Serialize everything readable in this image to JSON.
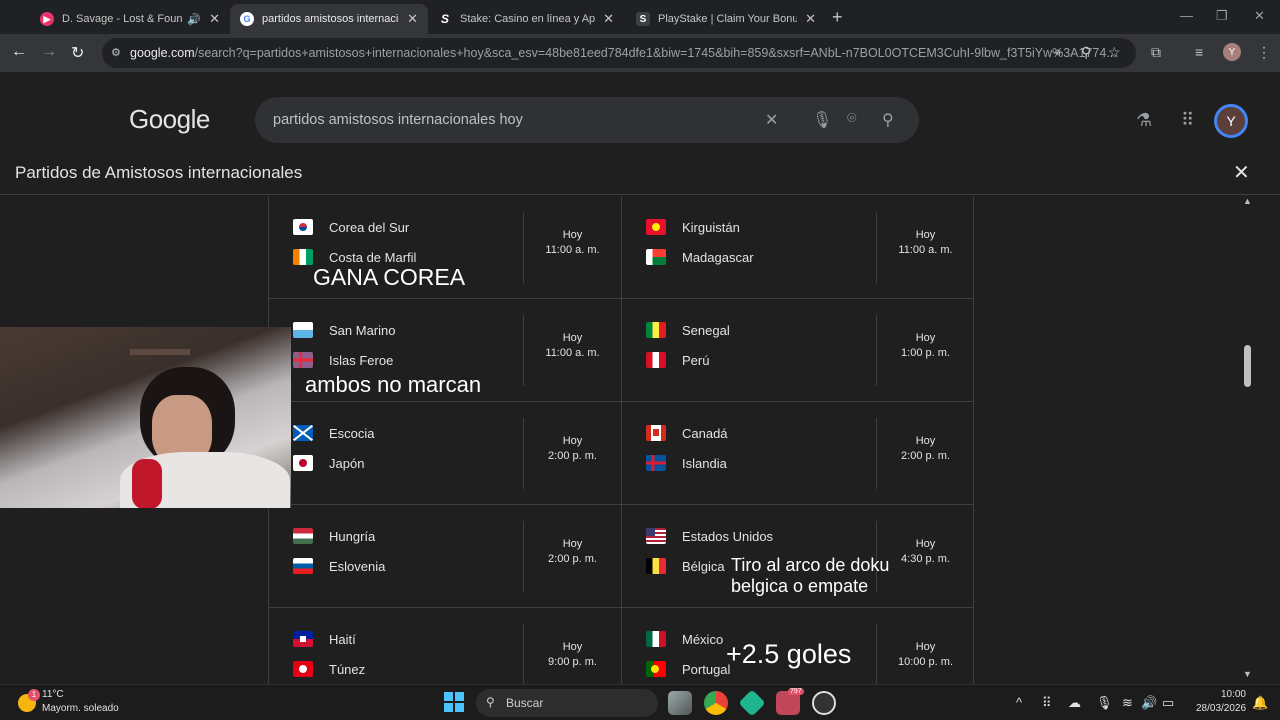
{
  "browser": {
    "tabs": [
      {
        "title": "D. Savage - Lost & Found (",
        "favicon_color": "#e8336d",
        "active": false
      },
      {
        "title": "partidos amistosos internaciona",
        "favicon_color": "#ffffff",
        "active": true
      },
      {
        "title": "Stake: Casino en línea y Apuest",
        "favicon_letter": "S",
        "active": false
      },
      {
        "title": "PlayStake | Claim Your Bonus",
        "favicon_letter": "S",
        "active": false
      }
    ],
    "url_host": "google.com",
    "url_rest": "/search?q=partidos+amistosos+internacionales+hoy&sca_esv=48be81eed784dfe1&biw=1745&bih=859&sxsrf=ANbL-n7BOL0OTCEM3CuhI-9lbw_f3T5iYw%3A1774...",
    "profile_initial": "Y"
  },
  "google": {
    "logo": "Google",
    "query": "partidos amistosos internacionales hoy",
    "avatar_initial": "Y"
  },
  "dialog": {
    "title": "Partidos de Amistosos internacionales",
    "matches": [
      {
        "home": "Corea del Sur",
        "away": "Costa de Marfil",
        "day": "Hoy",
        "time": "11:00 a. m."
      },
      {
        "home": "Kirguistán",
        "away": "Madagascar",
        "day": "Hoy",
        "time": "11:00 a. m."
      },
      {
        "home": "San Marino",
        "away": "Islas Feroe",
        "day": "Hoy",
        "time": "11:00 a. m."
      },
      {
        "home": "Senegal",
        "away": "Perú",
        "day": "Hoy",
        "time": "1:00 p. m."
      },
      {
        "home": "Escocia",
        "away": "Japón",
        "day": "Hoy",
        "time": "2:00 p. m."
      },
      {
        "home": "Canadá",
        "away": "Islandia",
        "day": "Hoy",
        "time": "2:00 p. m."
      },
      {
        "home": "Hungría",
        "away": "Eslovenia",
        "day": "Hoy",
        "time": "2:00 p. m."
      },
      {
        "home": "Estados Unidos",
        "away": "Bélgica",
        "day": "Hoy",
        "time": "4:30 p. m."
      },
      {
        "home": "Haití",
        "away": "Túnez",
        "day": "Hoy",
        "time": "9:00 p. m."
      },
      {
        "home": "México",
        "away": "Portugal",
        "day": "Hoy",
        "time": "10:00 p. m."
      }
    ]
  },
  "overlays": {
    "gana_corea": "GANA COREA",
    "ambos": "ambos no marcan",
    "tiro_1": "Tiro al arco de doku",
    "tiro_2": "belgica o empate",
    "goles": "+2.5 goles"
  },
  "taskbar": {
    "temp": "11°C",
    "weather": "Mayorm. soleado",
    "weather_badge": "1",
    "search": "Buscar",
    "clock_time": "10:00",
    "clock_date": "28/03/2026",
    "badge_count": "797"
  }
}
